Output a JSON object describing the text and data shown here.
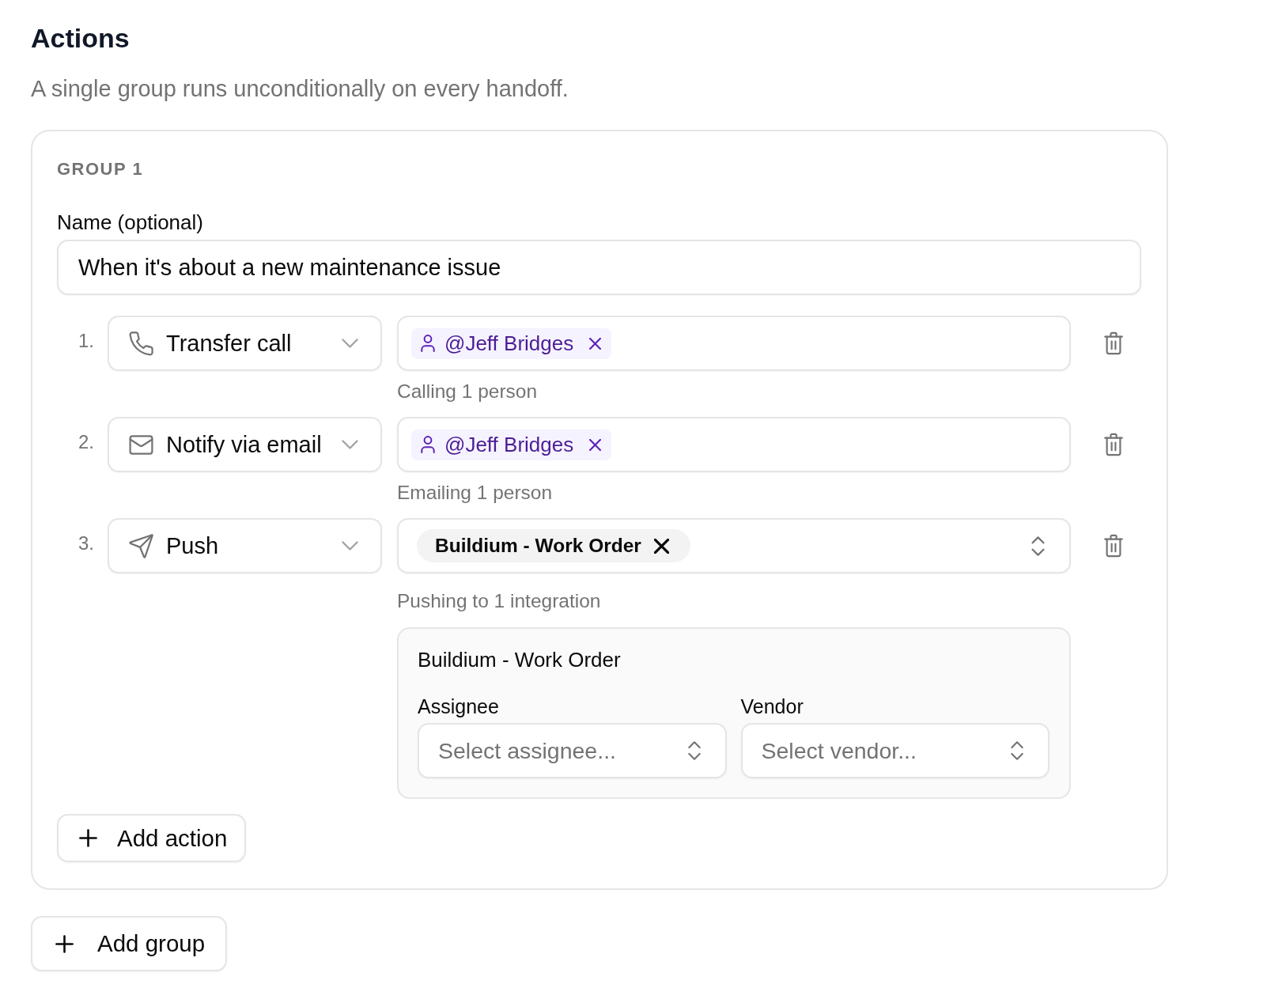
{
  "header": {
    "title": "Actions",
    "description": "A single group runs unconditionally on every handoff."
  },
  "groups": [
    {
      "label": "GROUP 1",
      "name_field": {
        "label": "Name (optional)",
        "value": "When it's about a new maintenance issue"
      },
      "actions": [
        {
          "number": "1.",
          "type": {
            "kind": "phone",
            "label": "Transfer call"
          },
          "targets": {
            "kind": "people",
            "chips": [
              {
                "label": "@Jeff Bridges"
              }
            ]
          },
          "summary": "Calling 1 person"
        },
        {
          "number": "2.",
          "type": {
            "kind": "email",
            "label": "Notify via email"
          },
          "targets": {
            "kind": "people",
            "chips": [
              {
                "label": "@Jeff Bridges"
              }
            ]
          },
          "summary": "Emailing 1 person"
        },
        {
          "number": "3.",
          "type": {
            "kind": "push",
            "label": "Push"
          },
          "targets": {
            "kind": "integration",
            "chips": [
              {
                "label": "Buildium - Work Order"
              }
            ]
          },
          "summary": "Pushing to 1 integration",
          "config": {
            "title": "Buildium - Work Order",
            "fields": [
              {
                "label": "Assignee",
                "placeholder": "Select assignee..."
              },
              {
                "label": "Vendor",
                "placeholder": "Select vendor..."
              }
            ]
          }
        }
      ],
      "add_action": "Add action"
    }
  ],
  "add_group": "Add group"
}
